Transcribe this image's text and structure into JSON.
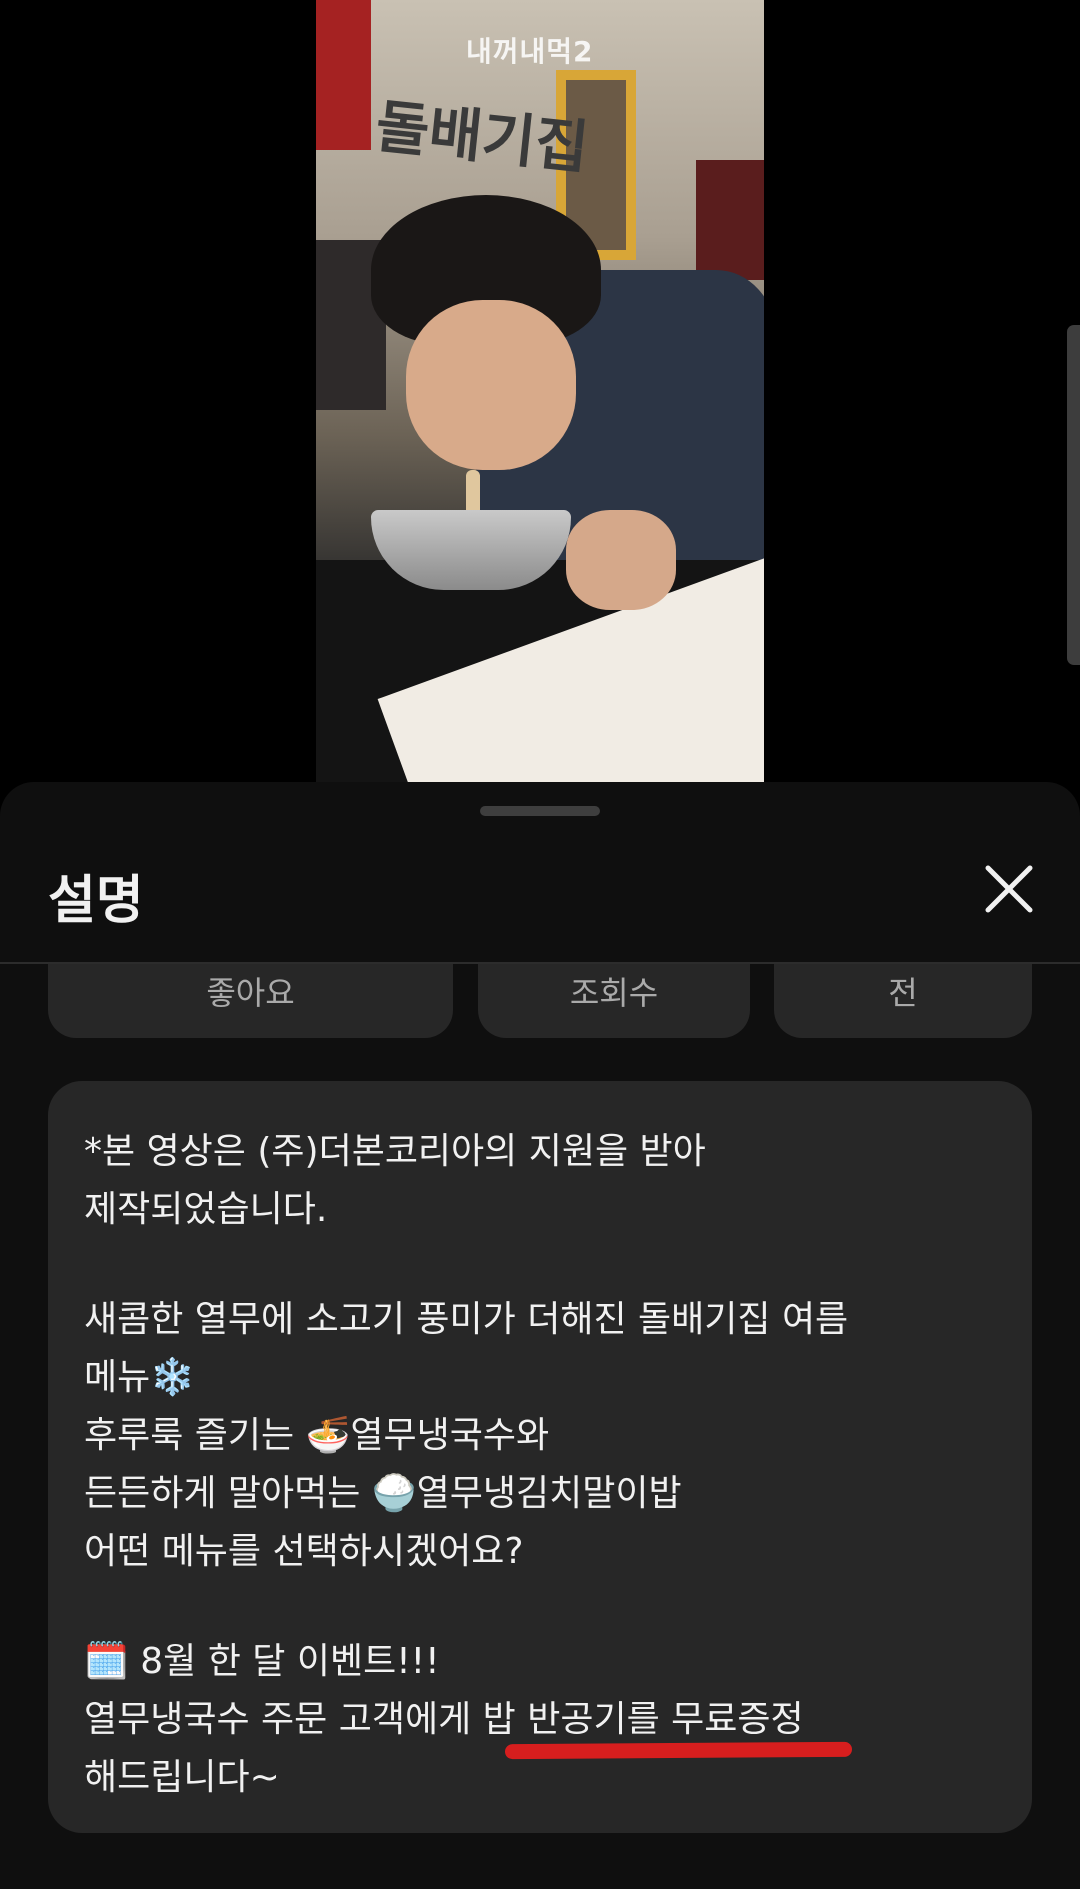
{
  "video": {
    "watermark": "내꺼내먹2",
    "wall_sign": "돌배기집"
  },
  "sheet": {
    "title": "설명",
    "close_icon": "close-icon"
  },
  "stats": {
    "likes_label": "좋아요",
    "views_label": "조회수",
    "date_label": "전"
  },
  "description": {
    "lines": [
      "*본 영상은 (주)더본코리아의 지원을 받아",
      "제작되었습니다.",
      "새콤한 열무에 소고기 풍미가 더해진 돌배기집 여름",
      "메뉴❄️",
      "후루룩 즐기는 🍜열무냉국수와",
      "든든하게 말아먹는 🍚열무냉김치말이밥",
      "어떤 메뉴를 선택하시겠어요?",
      "🗓️ 8월 한 달 이벤트!!!",
      "열무냉국수 주문 고객에게 밥 반공기를 무료증정",
      "해드립니다~"
    ]
  },
  "colors": {
    "sheet_bg": "#0f0f0f",
    "card_bg": "#272727",
    "underline": "#d71e1e"
  }
}
